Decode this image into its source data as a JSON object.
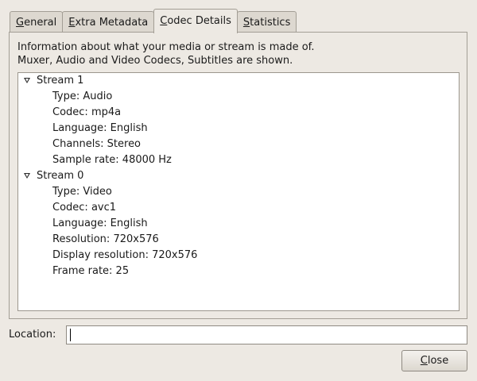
{
  "tabs": [
    {
      "label": "General",
      "active": false
    },
    {
      "label": "Extra Metadata",
      "active": false
    },
    {
      "label": "Codec Details",
      "active": true
    },
    {
      "label": "Statistics",
      "active": false
    }
  ],
  "description": {
    "line1": "Information about what your media or stream is made of.",
    "line2": "Muxer, Audio and Video Codecs, Subtitles are shown."
  },
  "streams": [
    {
      "label": "Stream 1",
      "expanded": true,
      "details": [
        "Type: Audio",
        "Codec: mp4a",
        "Language: English",
        "Channels: Stereo",
        "Sample rate: 48000 Hz"
      ]
    },
    {
      "label": "Stream 0",
      "expanded": true,
      "details": [
        "Type: Video",
        "Codec: avc1",
        "Language: English",
        "Resolution: 720x576",
        "Display resolution: 720x576",
        "Frame rate: 25"
      ]
    }
  ],
  "location": {
    "label": "Location:",
    "value": ""
  },
  "close_button": {
    "label": "Close"
  }
}
